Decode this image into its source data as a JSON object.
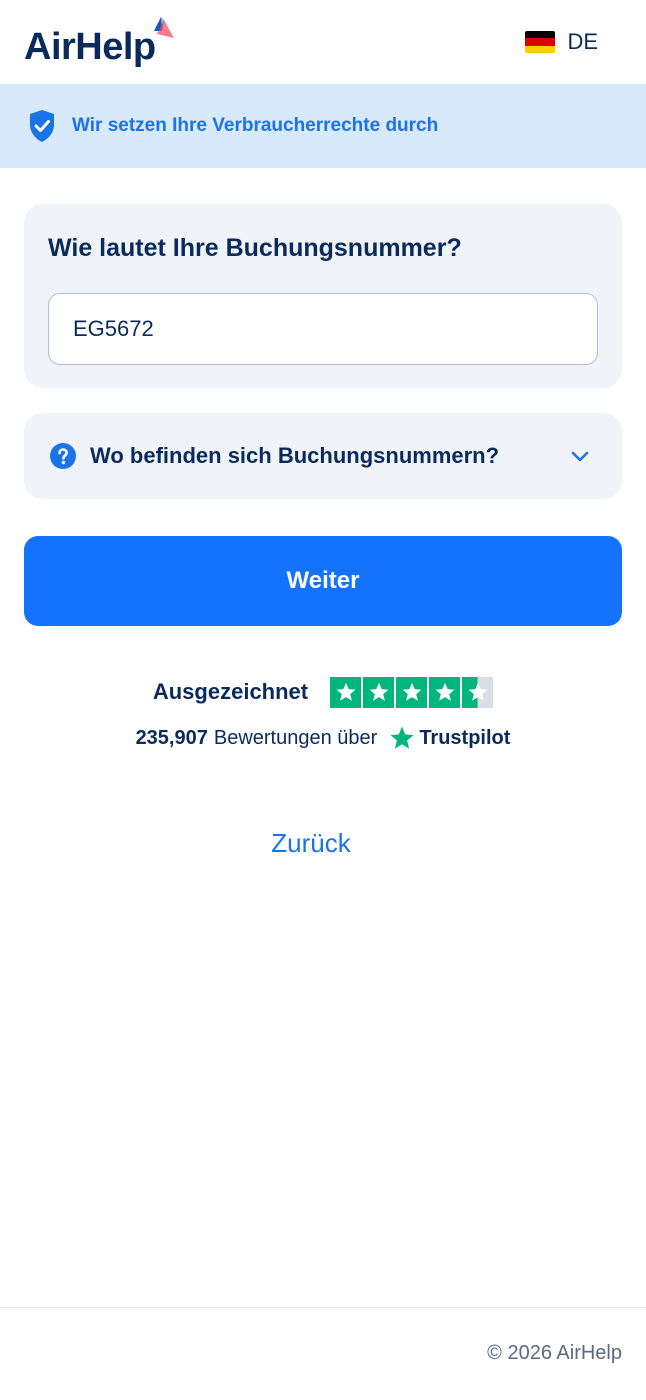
{
  "header": {
    "logo_text": "AirHelp",
    "language": {
      "code": "DE",
      "flag_colors": [
        "#000000",
        "#DD0000",
        "#FFCE00"
      ]
    }
  },
  "banner": {
    "text": "Wir setzen Ihre Verbraucherrechte durch",
    "icon": "shield-check-icon"
  },
  "booking": {
    "question": "Wie lautet Ihre Buchungsnummer?",
    "input_value": "EG5672"
  },
  "help_accordion": {
    "label": "Wo befinden sich Buchungsnummern?",
    "icon": "question-circle-icon",
    "expanded": false
  },
  "primary_button": {
    "label": "Weiter"
  },
  "trustpilot": {
    "rating_text": "Ausgezeichnet",
    "stars": 4.5,
    "review_count": "235,907",
    "reviews_text": "Bewertungen über",
    "brand": "Trustpilot"
  },
  "back_link": {
    "label": "Zurück"
  },
  "footer": {
    "copyright": "© 2026 AirHelp"
  },
  "colors": {
    "primary": "#1373FF",
    "navy": "#0B2A5C",
    "banner_bg": "#D9E9FC",
    "card_bg": "#F0F4F9",
    "trustpilot_green": "#00B67A"
  }
}
